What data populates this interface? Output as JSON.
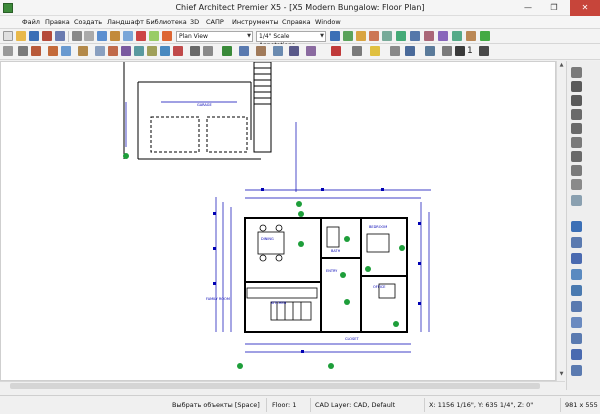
{
  "window": {
    "title": "Chief Architect Premier X5 - [X5 Modern Bungalow: Floor Plan]",
    "minimize": "—",
    "maximize": "❐",
    "close": "✕"
  },
  "menu": [
    "Файл",
    "Правка",
    "Создать",
    "Ландшафт",
    "Библиотека",
    "3D",
    "САПР",
    "Инструменты",
    "Справка",
    "Window"
  ],
  "toolbar": {
    "view_select": "Plan View",
    "scale_select": "1/4\" Scale Annotations",
    "floor_number": "1"
  },
  "plan": {
    "garage_label": "GARAGE",
    "room_labels": [
      "DINING",
      "KITCHEN",
      "ENTRY",
      "BEDROOM",
      "BATH",
      "FAMILY ROOM",
      "OFFICE",
      "CLOSET"
    ]
  },
  "status": {
    "hint": "Выбрать объекты [Space]",
    "floor": "Floor: 1",
    "cad_layer": "CAD Layer: CAD,  Default",
    "coords": "X: 1156 1/16\", Y: 635 1/4\", Z: 0\"",
    "size": "981 x 555"
  },
  "colors": {
    "wall": "#000000",
    "dimension": "#0000b4",
    "marker": "#1e9e3a",
    "close_button": "#c7453a"
  }
}
